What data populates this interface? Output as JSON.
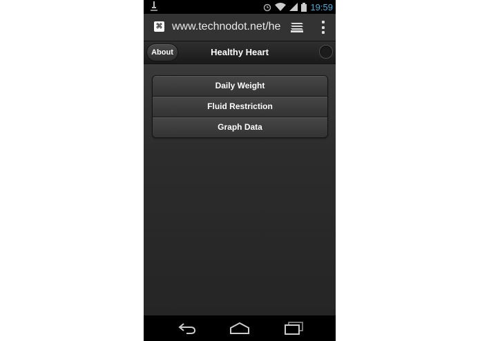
{
  "status_bar": {
    "time": "19:59",
    "icons": [
      "notification-icon",
      "alarm-icon",
      "wifi-icon",
      "signal-icon",
      "battery-icon"
    ],
    "clock_color": "#33b5e5"
  },
  "browser": {
    "url": "www.technodot.net/heart"
  },
  "header": {
    "about_label": "About",
    "title": "Healthy Heart"
  },
  "menu": {
    "items": [
      {
        "label": "Daily Weight"
      },
      {
        "label": "Fluid Restriction"
      },
      {
        "label": "Graph Data"
      }
    ]
  },
  "nav_bar": {
    "icons": [
      "back-icon",
      "home-icon",
      "recent-apps-icon"
    ]
  }
}
